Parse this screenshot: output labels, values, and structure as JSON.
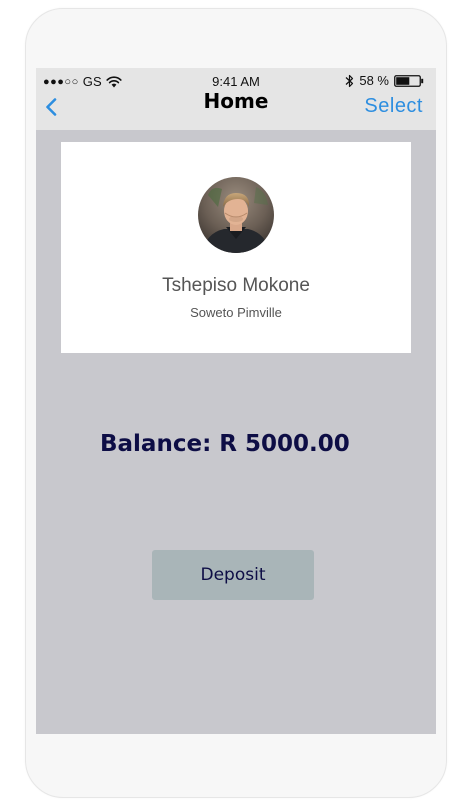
{
  "status_bar": {
    "carrier": "GS",
    "signal_dots": "●●●○○",
    "time": "9:41 AM",
    "battery_percent": "58 %",
    "battery_level": 0.58
  },
  "nav": {
    "title": "Home",
    "select_label": "Select",
    "back_icon": "chevron-left-icon"
  },
  "profile": {
    "name": "Tshepiso Mokone",
    "location": "Soweto Pimville"
  },
  "account": {
    "balance_text": "Balance: R 5000.00"
  },
  "actions": {
    "deposit_label": "Deposit"
  },
  "colors": {
    "accent": "#2d8ee0",
    "screen_bg": "#c8c8cd",
    "nav_bg": "#e5e5e5",
    "balance_text": "#0d0d45",
    "button_bg": "#a9b5b8"
  }
}
